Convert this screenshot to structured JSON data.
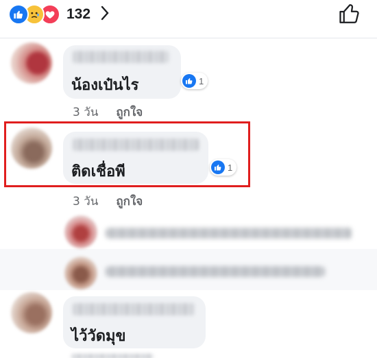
{
  "header": {
    "reaction_icons": [
      "like-icon",
      "sad-icon",
      "love-icon"
    ],
    "reaction_count": "132",
    "colors": {
      "like": "#1877f2",
      "sad": "#f7c23a",
      "love": "#f33e58"
    }
  },
  "comments": [
    {
      "text": "น้องเป๋นไร",
      "likes": "1",
      "time": "3 วัน",
      "like_label": "ถูกใจ"
    },
    {
      "text": "ติดเชื่อพี",
      "likes": "1",
      "time": "3 วัน",
      "like_label": "ถูกใจ",
      "highlighted": true
    },
    {
      "text": "ไว้วัดมุข"
    }
  ],
  "highlight_color": "#e01e1e"
}
